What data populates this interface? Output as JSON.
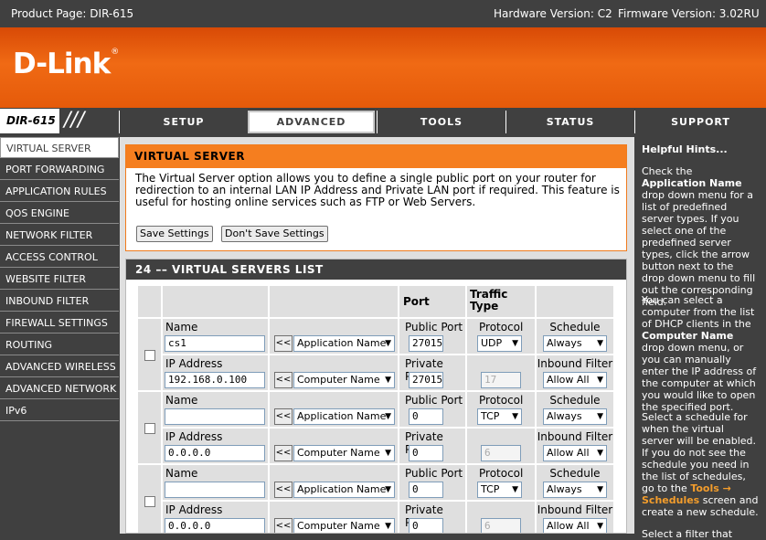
{
  "topbar": {
    "product": "Product Page: DIR-615",
    "hardware": "Hardware Version: C2",
    "firmware": "Firmware Version: 3.02RU"
  },
  "logo": {
    "text": "D-Link",
    "reg": "®"
  },
  "model": "DIR-615",
  "nav": [
    {
      "label": "SETUP"
    },
    {
      "label": "ADVANCED"
    },
    {
      "label": "TOOLS"
    },
    {
      "label": "STATUS"
    },
    {
      "label": "SUPPORT"
    }
  ],
  "sidebar": [
    {
      "label": "VIRTUAL SERVER"
    },
    {
      "label": "PORT FORWARDING"
    },
    {
      "label": "APPLICATION RULES"
    },
    {
      "label": "QOS ENGINE"
    },
    {
      "label": "NETWORK FILTER"
    },
    {
      "label": "ACCESS CONTROL"
    },
    {
      "label": "WEBSITE FILTER"
    },
    {
      "label": "INBOUND FILTER"
    },
    {
      "label": "FIREWALL SETTINGS"
    },
    {
      "label": "ROUTING"
    },
    {
      "label": "ADVANCED WIRELESS"
    },
    {
      "label": "ADVANCED NETWORK"
    },
    {
      "label": "IPv6"
    }
  ],
  "virtual_server": {
    "title": "VIRTUAL SERVER",
    "description": "The Virtual Server option allows you to define a single public port on your router for redirection to an internal LAN IP Address and Private LAN port if required. This feature is useful for hosting online services such as FTP or Web Servers.",
    "save_label": "Save Settings",
    "dont_save_label": "Don't Save Settings"
  },
  "list": {
    "title": "24 –– VIRTUAL SERVERS LIST",
    "header_port": "Port",
    "header_traffic": "Traffic Type",
    "labels": {
      "name": "Name",
      "ip": "IP Address",
      "public_port": "Public Port",
      "private_port": "Private Port",
      "protocol": "Protocol",
      "schedule": "Schedule",
      "inbound": "Inbound Filter",
      "arrow_button": "<<"
    },
    "rows": [
      {
        "name": "cs1",
        "ip": "192.168.0.100",
        "app": "Application Name",
        "computer": "Computer Name",
        "public_port": "27015",
        "private_port": "27015",
        "protocol": "UDP",
        "proto_num": "17",
        "schedule": "Always",
        "inbound": "Allow All"
      },
      {
        "name": "",
        "ip": "0.0.0.0",
        "app": "Application Name",
        "computer": "Computer Name",
        "public_port": "0",
        "private_port": "0",
        "protocol": "TCP",
        "proto_num": "6",
        "schedule": "Always",
        "inbound": "Allow All"
      },
      {
        "name": "",
        "ip": "0.0.0.0",
        "app": "Application Name",
        "computer": "Computer Name",
        "public_port": "0",
        "private_port": "0",
        "protocol": "TCP",
        "proto_num": "6",
        "schedule": "Always",
        "inbound": "Allow All"
      }
    ]
  },
  "hints": {
    "title": "Helpful Hints...",
    "p1_a": "Check the ",
    "p1_b": "Application Name",
    "p1_c": " drop down menu for a list of predefined server types. If you select one of the predefined server types, click the arrow button next to the drop down menu to fill out the corresponding field.",
    "p2_a": "You can select a computer from the list of DHCP clients in the ",
    "p2_b": "Computer Name",
    "p2_c": " drop down menu, or you can manually enter the IP address of the computer at which you would like to open the specified port.",
    "p3_a": "Select a schedule for when the virtual server will be enabled. If you do not see the schedule you need in the list of schedules, go to the ",
    "p3_link": "Tools → Schedules",
    "p3_c": " screen and create a new schedule.",
    "p4": "Select a filter that"
  },
  "colors": {
    "accent": "#f57e1f",
    "dark": "#404040",
    "link": "#f39d2c"
  }
}
